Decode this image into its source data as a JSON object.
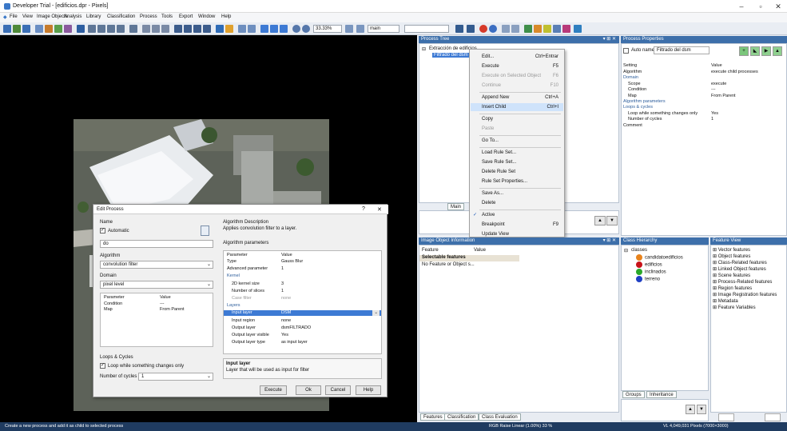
{
  "window": {
    "title": "Developer Trial - [edificios.dpr - Pixels]",
    "min": "–",
    "max": "▫",
    "close": "✕"
  },
  "menu": [
    "File",
    "View",
    "Image Objects",
    "Analysis",
    "Library",
    "Classification",
    "Process",
    "Tools",
    "Export",
    "Window",
    "Help"
  ],
  "toolbar": {
    "zoom": "33.33%",
    "layer": "main"
  },
  "process_tree": {
    "title": "Process Tree",
    "root": "Extracción de edificios",
    "child": "Filtrado del dsm",
    "tab": "Main"
  },
  "context_menu": {
    "items": [
      {
        "label": "Edit...",
        "shortcut": "Ctrl+Entrar",
        "enabled": true
      },
      {
        "label": "Execute",
        "shortcut": "F5",
        "enabled": true
      },
      {
        "label": "Execute on Selected Object",
        "shortcut": "F6",
        "enabled": false
      },
      {
        "label": "Continue",
        "shortcut": "F10",
        "enabled": false
      },
      {
        "label": "Append New",
        "shortcut": "Ctrl+A",
        "enabled": true
      },
      {
        "label": "Insert Child",
        "shortcut": "Ctrl+I",
        "enabled": true,
        "highlight": true
      },
      {
        "label": "Copy",
        "shortcut": "",
        "enabled": true
      },
      {
        "label": "Paste",
        "shortcut": "",
        "enabled": false
      },
      {
        "label": "Go To...",
        "shortcut": "",
        "enabled": true
      },
      {
        "label": "Load Rule Set...",
        "shortcut": "",
        "enabled": true
      },
      {
        "label": "Save Rule Set...",
        "shortcut": "",
        "enabled": true
      },
      {
        "label": "Delete Rule Set",
        "shortcut": "",
        "enabled": true
      },
      {
        "label": "Rule Set Properties...",
        "shortcut": "",
        "enabled": true
      },
      {
        "label": "Save As...",
        "shortcut": "",
        "enabled": true
      },
      {
        "label": "Delete",
        "shortcut": "",
        "enabled": true
      },
      {
        "label": "Active",
        "shortcut": "",
        "enabled": true,
        "checked": true
      },
      {
        "label": "Breakpoint",
        "shortcut": "F9",
        "enabled": true
      },
      {
        "label": "Update View",
        "shortcut": "",
        "enabled": true
      }
    ]
  },
  "process_properties": {
    "title": "Process Properties",
    "auto_name_label": "Auto name",
    "auto_name_value": "Filtrado del dsm",
    "headers": [
      "Setting",
      "Value"
    ],
    "rows": [
      {
        "k": "Algorithm",
        "v": "execute child processes",
        "indent": 0,
        "group": false
      },
      {
        "k": "Domain",
        "v": "",
        "indent": 0,
        "group": true
      },
      {
        "k": "Scope",
        "v": "execute",
        "indent": 1,
        "group": false
      },
      {
        "k": "Condition",
        "v": "---",
        "indent": 1,
        "group": false
      },
      {
        "k": "Map",
        "v": "From Parent",
        "indent": 1,
        "group": false
      },
      {
        "k": "Algorithm parameters",
        "v": "",
        "indent": 0,
        "group": true
      },
      {
        "k": "Loops & cycles",
        "v": "",
        "indent": 0,
        "group": true
      },
      {
        "k": "Loop while something changes only",
        "v": "Yes",
        "indent": 1,
        "group": false
      },
      {
        "k": "Number of cycles",
        "v": "1",
        "indent": 1,
        "group": false
      },
      {
        "k": "Comment",
        "v": "",
        "indent": 0,
        "group": false
      }
    ]
  },
  "image_object_info": {
    "title": "Image Object Information",
    "headers": [
      "Feature",
      "Value"
    ],
    "selectable": "Selectable features",
    "note": "No Feature or Object s...",
    "tabs": [
      "Features",
      "Classification",
      "Class Evaluation"
    ]
  },
  "class_hierarchy": {
    "title": "Class Hierarchy",
    "root": "classes",
    "classes": [
      {
        "name": "candidatoedificios",
        "color": "#e8831c"
      },
      {
        "name": "edificios",
        "color": "#c8131a"
      },
      {
        "name": "inclinados",
        "color": "#2aa82a"
      },
      {
        "name": "terreno",
        "color": "#1f3fc4"
      }
    ],
    "tabs": [
      "Groups",
      "Inheritance"
    ]
  },
  "feature_view": {
    "title": "Feature View",
    "items": [
      "Vector features",
      "Object features",
      "Class-Related features",
      "Linked Object features",
      "Scene features",
      "Process-Related features",
      "Region features",
      "Image Registration features",
      "Metadata",
      "Feature Variables"
    ]
  },
  "edit_process": {
    "title": "Edit Process",
    "help_q": "?",
    "close": "✕",
    "name_label": "Name",
    "automatic_label": "Automatic",
    "name_value": "do",
    "algorithm_label": "Algorithm",
    "algorithm_value": "convolution filter",
    "domain_label": "Domain",
    "domain_value": "pixel level",
    "domain_headers": [
      "Parameter",
      "Value"
    ],
    "domain_rows": [
      {
        "k": "Condition",
        "v": "---"
      },
      {
        "k": "Map",
        "v": "From Parent"
      }
    ],
    "loops_label": "Loops & Cycles",
    "loop_check_label": "Loop while something changes only",
    "cycles_label": "Number of cycles",
    "cycles_value": "1",
    "alg_desc_label": "Algorithm Description",
    "alg_desc": "Applies convolution filter to a layer.",
    "alg_params_label": "Algorithm parameters",
    "param_headers": [
      "Parameter",
      "Value"
    ],
    "params": [
      {
        "k": "Type",
        "v": "Gauss Blur",
        "indent": 0,
        "group": false
      },
      {
        "k": "Advanced parameter",
        "v": "1",
        "indent": 0,
        "group": false
      },
      {
        "k": "Kernel",
        "v": "",
        "indent": 0,
        "group": true
      },
      {
        "k": "2D kernel size",
        "v": "3",
        "indent": 1,
        "group": false
      },
      {
        "k": "Number of slices",
        "v": "1",
        "indent": 1,
        "group": false
      },
      {
        "k": "Case filter",
        "v": "none",
        "indent": 1,
        "group": false,
        "muted": true
      },
      {
        "k": "Layers",
        "v": "",
        "indent": 0,
        "group": true
      },
      {
        "k": "Input layer",
        "v": "DSM",
        "indent": 1,
        "group": false,
        "selected": true
      },
      {
        "k": "Input region",
        "v": "none",
        "indent": 1,
        "group": false
      },
      {
        "k": "Output layer",
        "v": "dsmFILTRADO",
        "indent": 1,
        "group": false
      },
      {
        "k": "Output layer visible",
        "v": "Yes",
        "indent": 1,
        "group": false
      },
      {
        "k": "Output layer type",
        "v": "as input layer",
        "indent": 1,
        "group": false
      }
    ],
    "help_title": "Input layer",
    "help_text": "Layer that will be used as input for filter",
    "buttons": {
      "execute": "Execute",
      "ok": "Ok",
      "cancel": "Cancel",
      "help": "Help"
    }
  },
  "status": {
    "left": "Create a new process and add it as child to selected process",
    "mid": "RGB  Raise  Linear (1.00%)  33 %",
    "right": "VL  4,049,031 Pixels  (7000×3000)"
  }
}
